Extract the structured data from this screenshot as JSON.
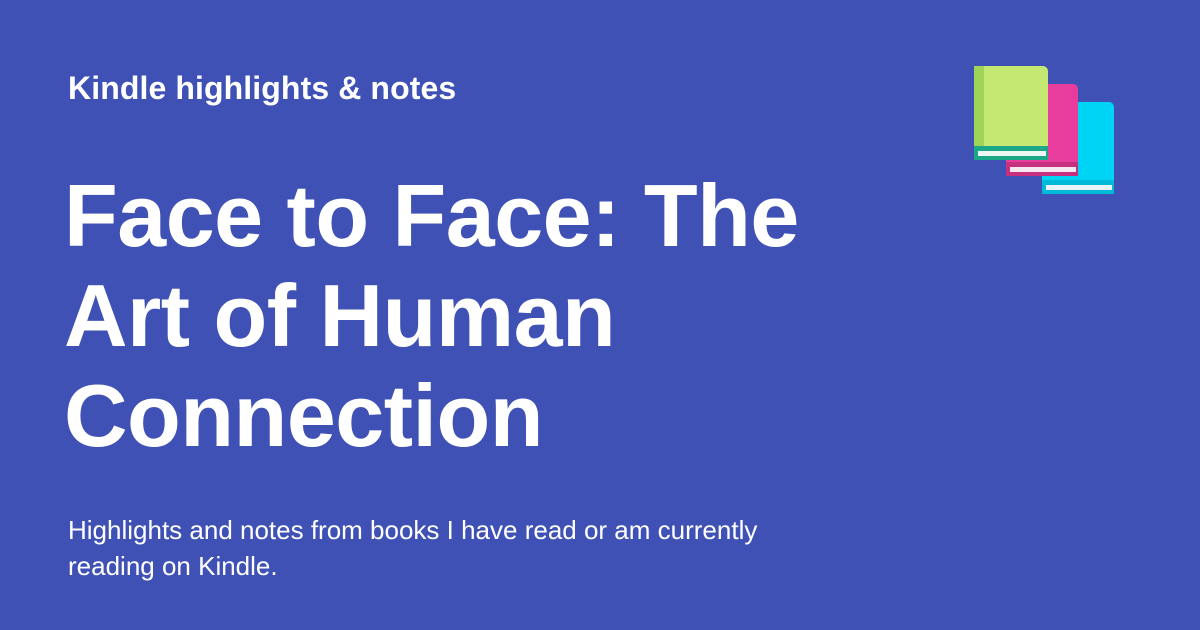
{
  "header": {
    "site_name": "Kindle highlights & notes"
  },
  "main": {
    "title": "Face to Face: The Art of Human Connection",
    "description": "Highlights and notes from books I have read or am currently reading on Kindle."
  },
  "logo": {
    "icon": "books-icon",
    "colors": [
      "#c5e872",
      "#e93d9e",
      "#00d4f5"
    ]
  },
  "theme": {
    "background": "#3f51b5",
    "text": "#ffffff"
  }
}
